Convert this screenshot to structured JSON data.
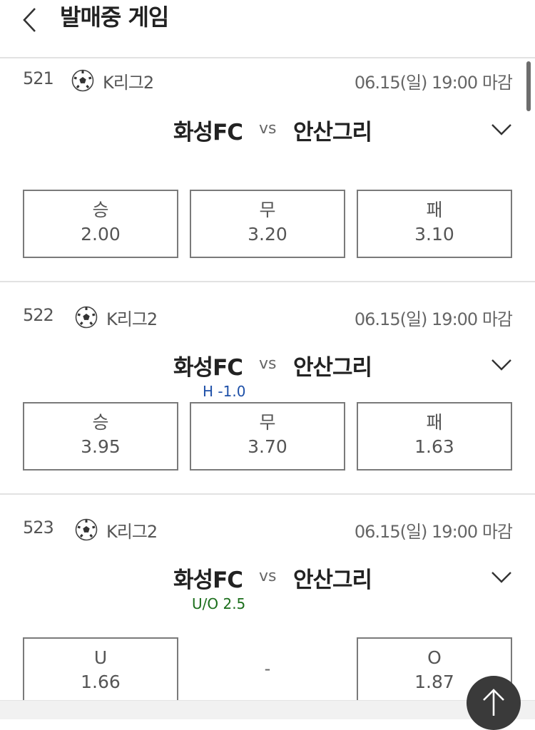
{
  "header": {
    "title": "발매중 게임"
  },
  "games": [
    {
      "number": "521",
      "league": "K리그2",
      "time": "06.15(일) 19:00 마감",
      "home": "화성FC",
      "vs": "vs",
      "away": "안산그리",
      "condition": "",
      "odds": [
        {
          "label": "승",
          "value": "2.00"
        },
        {
          "label": "무",
          "value": "3.20"
        },
        {
          "label": "패",
          "value": "3.10"
        }
      ]
    },
    {
      "number": "522",
      "league": "K리그2",
      "time": "06.15(일) 19:00 마감",
      "home": "화성FC",
      "vs": "vs",
      "away": "안산그리",
      "condition": "H -1.0",
      "odds": [
        {
          "label": "승",
          "value": "3.95"
        },
        {
          "label": "무",
          "value": "3.70"
        },
        {
          "label": "패",
          "value": "1.63"
        }
      ]
    },
    {
      "number": "523",
      "league": "K리그2",
      "time": "06.15(일) 19:00 마감",
      "home": "화성FC",
      "vs": "vs",
      "away": "안산그리",
      "condition": "U/O 2.5",
      "odds": [
        {
          "label": "U",
          "value": "1.66"
        },
        {
          "label": "-",
          "value": ""
        },
        {
          "label": "O",
          "value": "1.87"
        }
      ]
    }
  ],
  "colors": {
    "handicap": "#1e50a8",
    "under_over": "#1b6e1b",
    "border": "#7a7a7a"
  }
}
